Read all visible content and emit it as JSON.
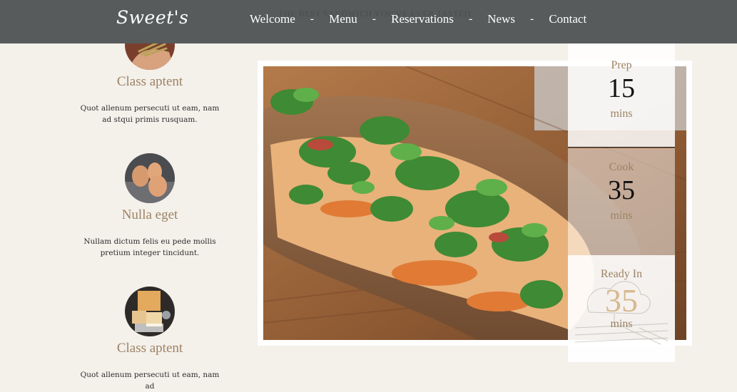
{
  "header": {
    "logo": "Sweet's",
    "tagline": "THE BEST SANDWICH YOU'VE EVER TASTED",
    "nav": [
      "Welcome",
      "Menu",
      "Reservations",
      "News",
      "Contact"
    ],
    "separator": "-"
  },
  "features": [
    {
      "title": "Class aptent",
      "text": "Quot allenum persecuti ut eam, nam ad stqui primis rusquam.",
      "image": "asparagus-hand"
    },
    {
      "title": "Nulla eget",
      "text": "Nullam dictum felis eu pede mollis pretium integer tincidunt.",
      "image": "eggs"
    },
    {
      "title": "Class aptent",
      "text": "Quot allenum persecuti ut eam, nam ad",
      "image": "cheese-board"
    }
  ],
  "timings": [
    {
      "label": "Prep",
      "value": "15",
      "unit": "mins"
    },
    {
      "label": "Cook",
      "value": "35",
      "unit": "mins"
    },
    {
      "label": "Ready In",
      "value": "35",
      "unit": "mins"
    }
  ],
  "colors": {
    "header_bg": "#575b5c",
    "page_bg": "#f4f0ea",
    "accent_tan": "#9c8364",
    "ready_number": "#d7b98d"
  }
}
